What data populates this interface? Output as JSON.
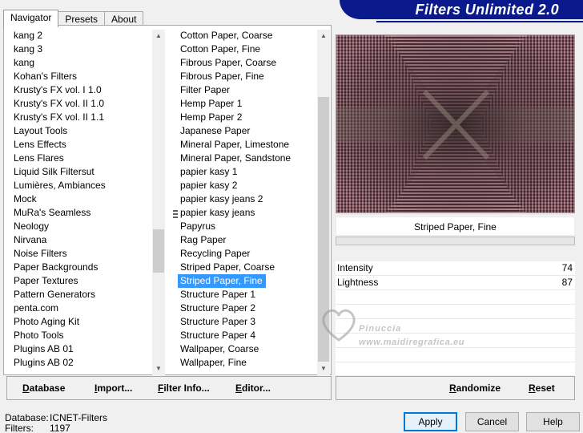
{
  "banner": {
    "title": "Filters Unlimited 2.0"
  },
  "tabs": [
    {
      "label": "Navigator",
      "active": true
    },
    {
      "label": "Presets",
      "active": false
    },
    {
      "label": "About",
      "active": false
    }
  ],
  "categories": {
    "items": [
      "kang 2",
      "kang 3",
      "kang",
      "Kohan's Filters",
      "Krusty's FX vol. I 1.0",
      "Krusty's FX vol. II 1.0",
      "Krusty's FX vol. II 1.1",
      "Layout Tools",
      "Lens Effects",
      "Lens Flares",
      "Liquid Silk Filtersut",
      "Lumières, Ambiances",
      "Mock",
      "MuRa's Seamless",
      "Neology",
      "Nirvana",
      "Noise Filters",
      "Paper Backgrounds",
      "Paper Textures",
      "Pattern Generators",
      "penta.com",
      "Photo Aging Kit",
      "Photo Tools",
      "Plugins AB 01",
      "Plugins AB 02"
    ]
  },
  "filters": {
    "items": [
      "Cotton Paper, Coarse",
      "Cotton Paper, Fine",
      "Fibrous Paper, Coarse",
      "Fibrous Paper, Fine",
      "Filter Paper",
      "Hemp Paper 1",
      "Hemp Paper 2",
      "Japanese Paper",
      "Mineral Paper, Limestone",
      "Mineral Paper, Sandstone",
      "papier kasy 1",
      "papier kasy 2",
      "papier kasy jeans 2",
      "papier kasy jeans",
      "Papyrus",
      "Rag Paper",
      "Recycling Paper",
      "Striped Paper, Coarse",
      "Striped Paper, Fine",
      "Structure Paper 1",
      "Structure Paper 2",
      "Structure Paper 3",
      "Structure Paper 4",
      "Wallpaper, Coarse",
      "Wallpaper, Fine"
    ],
    "selected_index": 18
  },
  "toolbar": {
    "database_u": "D",
    "database_rest": "atabase",
    "import_u": "I",
    "import_rest": "mport...",
    "filterinfo_u": "F",
    "filterinfo_rest": "ilter Info...",
    "editor_u": "E",
    "editor_rest": "ditor...",
    "randomize_u": "R",
    "randomize_rest": "andomize",
    "reset_u": "R",
    "reset_rest": "eset"
  },
  "preview": {
    "filter_name": "Striped Paper, Fine",
    "progress": 0
  },
  "params": [
    {
      "label": "Intensity",
      "value": "74"
    },
    {
      "label": "Lightness",
      "value": "87"
    }
  ],
  "status": {
    "database_label": "Database:",
    "database_value": "ICNET-Filters",
    "filters_label": "Filters:",
    "filters_value": "1197"
  },
  "buttons": {
    "apply": "Apply",
    "cancel": "Cancel",
    "help": "Help"
  },
  "watermark": {
    "line1": "Pinuccia",
    "line2": "www.maidiregrafica.eu"
  },
  "colors": {
    "banner": "#0a1a8c",
    "selection": "#3399ff",
    "preview_base": "#5a3a44"
  }
}
